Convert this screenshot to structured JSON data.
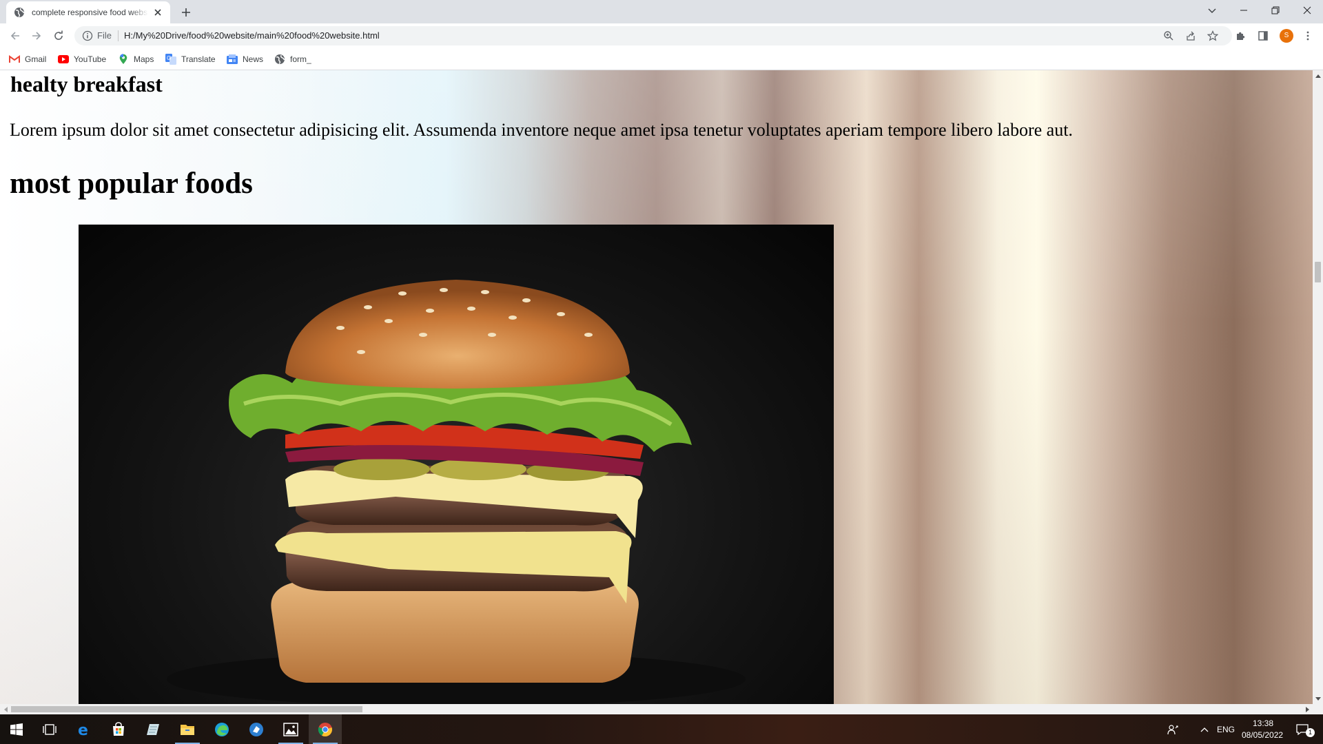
{
  "browser": {
    "tab_title": "complete responsive food website",
    "url_scheme": "File",
    "url": "H:/My%20Drive/food%20website/main%20food%20website.html",
    "profile_initial": "S"
  },
  "bookmarks": [
    {
      "label": "Gmail",
      "icon": "gmail-icon"
    },
    {
      "label": "YouTube",
      "icon": "youtube-icon"
    },
    {
      "label": "Maps",
      "icon": "maps-icon"
    },
    {
      "label": "Translate",
      "icon": "translate-icon"
    },
    {
      "label": "News",
      "icon": "news-icon"
    },
    {
      "label": "form_",
      "icon": "globe-icon"
    }
  ],
  "page": {
    "subheading": "healty breakfast",
    "paragraph": "Lorem ipsum dolor sit amet consectetur adipisicing elit. Assumenda inventore neque amet ipsa tenetur voluptates aperiam tempore libero labore aut.",
    "heading": "most popular foods",
    "image_subject": "burger"
  },
  "taskbar": {
    "language": "ENG",
    "time": "13:38",
    "date": "08/05/2022",
    "notification_count": "1",
    "apps": [
      "start-icon",
      "task-view-icon",
      "edge-legacy-icon",
      "store-icon",
      "notes-icon",
      "file-explorer-icon",
      "edge-icon",
      "app-icon",
      "photos-icon",
      "chrome-icon"
    ]
  },
  "colors": {
    "accent_profile": "#e8710a",
    "tabstrip": "#dee1e6"
  }
}
